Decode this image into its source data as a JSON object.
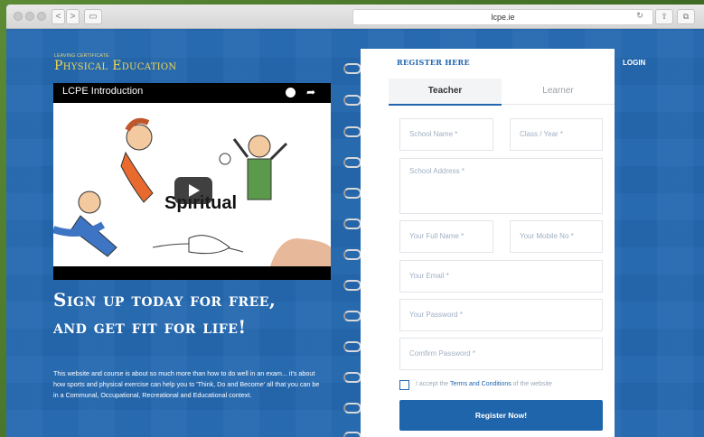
{
  "browser": {
    "url": "lcpe.ie",
    "back": "<",
    "forward": ">"
  },
  "site": {
    "logo_small": "LEAVING CERTIFICATE",
    "logo_big": "Physical Education",
    "login": "LOGIN"
  },
  "video": {
    "title": "LCPE Introduction",
    "overlay_word": "Spiritual"
  },
  "hero": {
    "headline_line1": "Sign up today for free,",
    "headline_line2": "and get fit for life!",
    "description": "This website and course is about so much more than how to do well in an exam... it's about how sports and physical exercise can help you to 'Think, Do and Become' all that you can be in a Communal, Occupational, Recreational and Educational context."
  },
  "form": {
    "title": "REGISTER HERE",
    "tabs": [
      {
        "label": "Teacher"
      },
      {
        "label": "Learner"
      }
    ],
    "school_name": "School Name *",
    "class_year": "Class / Year *",
    "school_address": "School Address *",
    "full_name": "Your Full Name *",
    "mobile_no": "Your Mobile No *",
    "email": "Your Email *",
    "password": "Your Password *",
    "confirm_password": "Comfirm Password *",
    "terms_prefix": "I accept the ",
    "terms_link": "Terms and Conditions",
    "terms_suffix": " of the website",
    "submit": "Register Now!"
  },
  "colors": {
    "page_bg": "#2569b0",
    "accent": "#2166ad",
    "logo_gold": "#f1d64f"
  }
}
